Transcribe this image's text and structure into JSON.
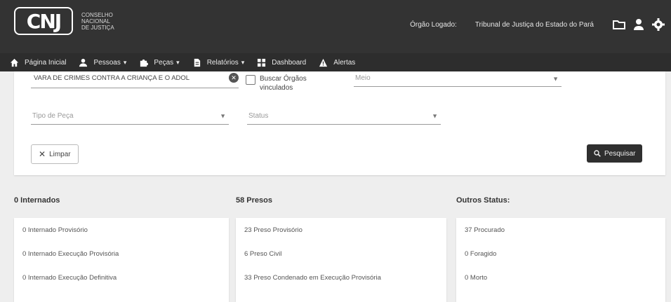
{
  "header": {
    "logo_mark": "CNJ",
    "logo_lines": [
      "CONSELHO",
      "NACIONAL",
      "DE JUSTIÇA"
    ],
    "orgao_logado": "Órgão Logado:",
    "tribunal": "Tribunal de Justiça do Estado do Pará",
    "icons": [
      "folder-icon",
      "user-icon",
      "gear-icon"
    ]
  },
  "nav": {
    "items": [
      {
        "label": "Página Inicial",
        "icon": "home-icon",
        "caret": ""
      },
      {
        "label": "Pessoas",
        "icon": "person-icon",
        "caret": "▾"
      },
      {
        "label": "Peças",
        "icon": "puzzle-icon",
        "caret": "▾"
      },
      {
        "label": "Relatórios",
        "icon": "document-icon",
        "caret": "▾"
      },
      {
        "label": "Dashboard",
        "icon": "dashboard-icon",
        "caret": ""
      },
      {
        "label": "Alertas",
        "icon": "warning-icon",
        "caret": ""
      }
    ]
  },
  "filters": {
    "vara_value": "VARA DE CRIMES CONTRA A CRIANÇA E O ADOL",
    "buscar_vinculados": "Buscar Órgãos vinculados",
    "orgao_placeholder": "Meio",
    "tipo_peca_placeholder": "Tipo de Peça",
    "status_placeholder": "Status",
    "limpar_label": "Limpar",
    "pesquisar_label": "Pesquisar"
  },
  "columns": [
    {
      "title": "0 Internados",
      "rows": [
        "0 Internado Provisório",
        "0 Internado Execução Provisória",
        "0 Internado Execução Definitiva"
      ]
    },
    {
      "title": "58 Presos",
      "rows": [
        "23 Preso Provisório",
        "6 Preso Civil",
        "33 Preso Condenado em Execução Provisória"
      ]
    },
    {
      "title": "Outros Status:",
      "rows": [
        "37 Procurado",
        "0 Foragido",
        "0 Morto"
      ]
    }
  ]
}
